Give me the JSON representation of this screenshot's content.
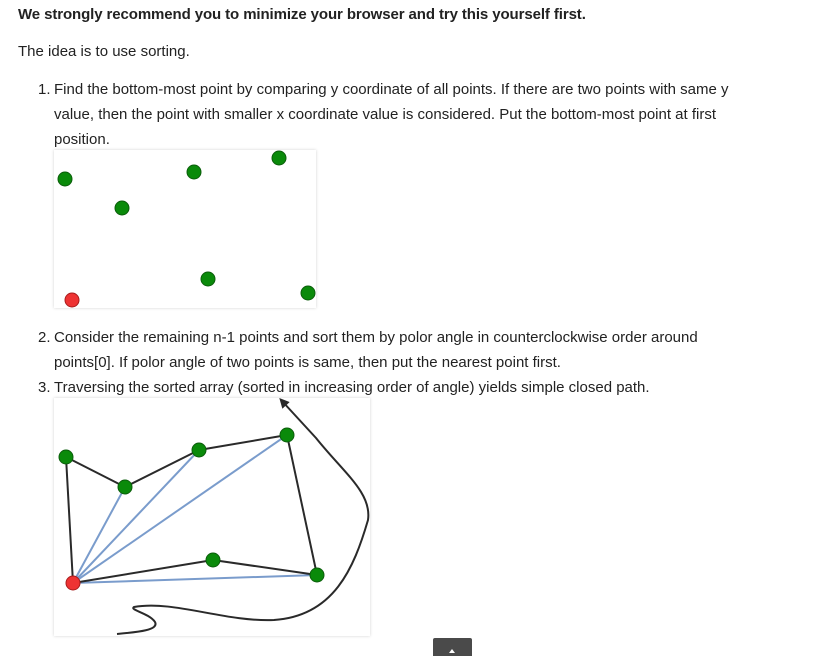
{
  "article": {
    "intro_bold": "We strongly recommend you to minimize your browser and try this yourself first.",
    "intro": "The idea is to use sorting.",
    "steps": [
      {
        "number": "1.",
        "lines": [
          "Find the bottom-most point by comparing y coordinate of all points. If there are two points with same y",
          "value, then the point with smaller x coordinate value is considered. Put the bottom-most point at first",
          "position."
        ]
      },
      {
        "number": "2.",
        "lines": [
          "Consider the remaining n-1 points and sort them by polor angle in counterclockwise order around",
          "points[0]. If polor angle of two points is same, then put the nearest point first."
        ]
      },
      {
        "number": "3.",
        "lines": [
          "Traversing the sorted array (sorted in increasing order of angle) yields simple closed path."
        ]
      }
    ]
  },
  "figures": {
    "colors": {
      "point": "#0a8a0a",
      "bottom_point": "#ee3333",
      "path": "#2a2a2a",
      "ray": "#7a9ccc"
    }
  },
  "scroll_to_top": {
    "icon": "chevron-up-icon"
  }
}
